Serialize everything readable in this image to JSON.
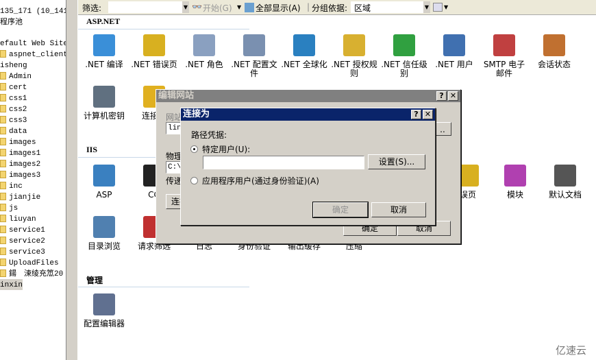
{
  "tree": {
    "server": "135_171 (10_141_",
    "app_pools": "程序池",
    "sites": [
      {
        "label": "efault Web Site",
        "folder": false
      },
      {
        "label": "aspnet_client",
        "folder": true
      },
      {
        "label": "isheng",
        "folder": false
      },
      {
        "label": "Admin",
        "folder": true
      },
      {
        "label": "cert",
        "folder": true
      },
      {
        "label": "css1",
        "folder": true
      },
      {
        "label": "css2",
        "folder": true
      },
      {
        "label": "css3",
        "folder": true
      },
      {
        "label": "data",
        "folder": true
      },
      {
        "label": "images",
        "folder": true
      },
      {
        "label": "images1",
        "folder": true
      },
      {
        "label": "images2",
        "folder": true
      },
      {
        "label": "images3",
        "folder": true
      },
      {
        "label": "inc",
        "folder": true
      },
      {
        "label": "jianjie",
        "folder": true
      },
      {
        "label": "js",
        "folder": true
      },
      {
        "label": "liuyan",
        "folder": true
      },
      {
        "label": "service1",
        "folder": true
      },
      {
        "label": "service2",
        "folder": true
      },
      {
        "label": "service3",
        "folder": true
      },
      {
        "label": "UploadFiles",
        "folder": true
      },
      {
        "label": "鍚　涑绫充笟20",
        "folder": true
      },
      {
        "label": "inxin",
        "folder": false,
        "selected": true
      }
    ]
  },
  "toolbar": {
    "filter_label": "筛选:",
    "start_label": "开始(G)",
    "show_all_label": "全部显示(A)",
    "group_by_label": "分组依据:",
    "group_by_value": "区域"
  },
  "sections": {
    "aspnet": "ASP.NET",
    "iis": "IIS",
    "manage": "管理"
  },
  "aspnet_features": [
    {
      "label": ".NET 编译",
      "icon": "compile-icon",
      "color": "#3a8fd8"
    },
    {
      "label": ".NET 错误页",
      "icon": "error-page-icon",
      "color": "#d8b020"
    },
    {
      "label": ".NET 角色",
      "icon": "roles-icon",
      "color": "#8aa0c0"
    },
    {
      "label": ".NET 配置文件",
      "icon": "profile-icon",
      "color": "#7a90b0"
    },
    {
      "label": ".NET 全球化",
      "icon": "globe-icon",
      "color": "#2a80c0"
    },
    {
      "label": ".NET 授权规则",
      "icon": "lock-icon",
      "color": "#d8b030"
    },
    {
      "label": ".NET 信任级别",
      "icon": "trust-icon",
      "color": "#30a040"
    },
    {
      "label": ".NET 用户",
      "icon": "users-icon",
      "color": "#4070b0"
    },
    {
      "label": "SMTP 电子邮件",
      "icon": "mail-icon",
      "color": "#c04040"
    },
    {
      "label": "会话状态",
      "icon": "session-icon",
      "color": "#c07030"
    },
    {
      "label": "计算机密钥",
      "icon": "key-icon",
      "color": "#607080"
    },
    {
      "label": "连接字",
      "icon": "db-icon",
      "color": "#e0b020"
    }
  ],
  "iis_features": [
    {
      "label": "ASP",
      "icon": "asp-icon",
      "color": "#3a80c0"
    },
    {
      "label": "CG",
      "icon": "cgi-icon",
      "color": "#222222"
    },
    {
      "label": "误页",
      "icon": "error-page-icon",
      "color": "#d8b020"
    },
    {
      "label": "模块",
      "icon": "modules-icon",
      "color": "#b040b0"
    },
    {
      "label": "默认文档",
      "icon": "default-doc-icon",
      "color": "#555555"
    },
    {
      "label": "目录浏览",
      "icon": "dir-browse-icon",
      "color": "#5080b0"
    },
    {
      "label": "请求筛选",
      "icon": "request-filter-icon",
      "color": "#c03030"
    },
    {
      "label": "日志",
      "icon": "log-icon",
      "color": "#888888"
    },
    {
      "label": "身份验证",
      "icon": "auth-icon",
      "color": "#888888"
    },
    {
      "label": "输出缓存",
      "icon": "cache-icon",
      "color": "#888888"
    },
    {
      "label": "压缩",
      "icon": "compress-icon",
      "color": "#888888"
    }
  ],
  "manage_features": [
    {
      "label": "配置编辑器",
      "icon": "config-editor-icon",
      "color": "#607090"
    }
  ],
  "edit_site_dialog": {
    "title": "编辑网站",
    "site_label": "网站",
    "site_value": "lin",
    "path_label": "物理",
    "path_value": "C:\\",
    "pass_label": "传递",
    "connect_button": "连接",
    "ok": "确定",
    "cancel": "取消"
  },
  "connect_as_dialog": {
    "title": "连接为",
    "credentials_label": "路径凭据:",
    "specific_user": "特定用户(U):",
    "user_value": "",
    "settings_button": "设置(S)...",
    "app_user": "应用程序用户(通过身份验证)(A)",
    "ok": "确定",
    "cancel": "取消",
    "selected": "specific_user"
  },
  "watermark": "亿速云"
}
